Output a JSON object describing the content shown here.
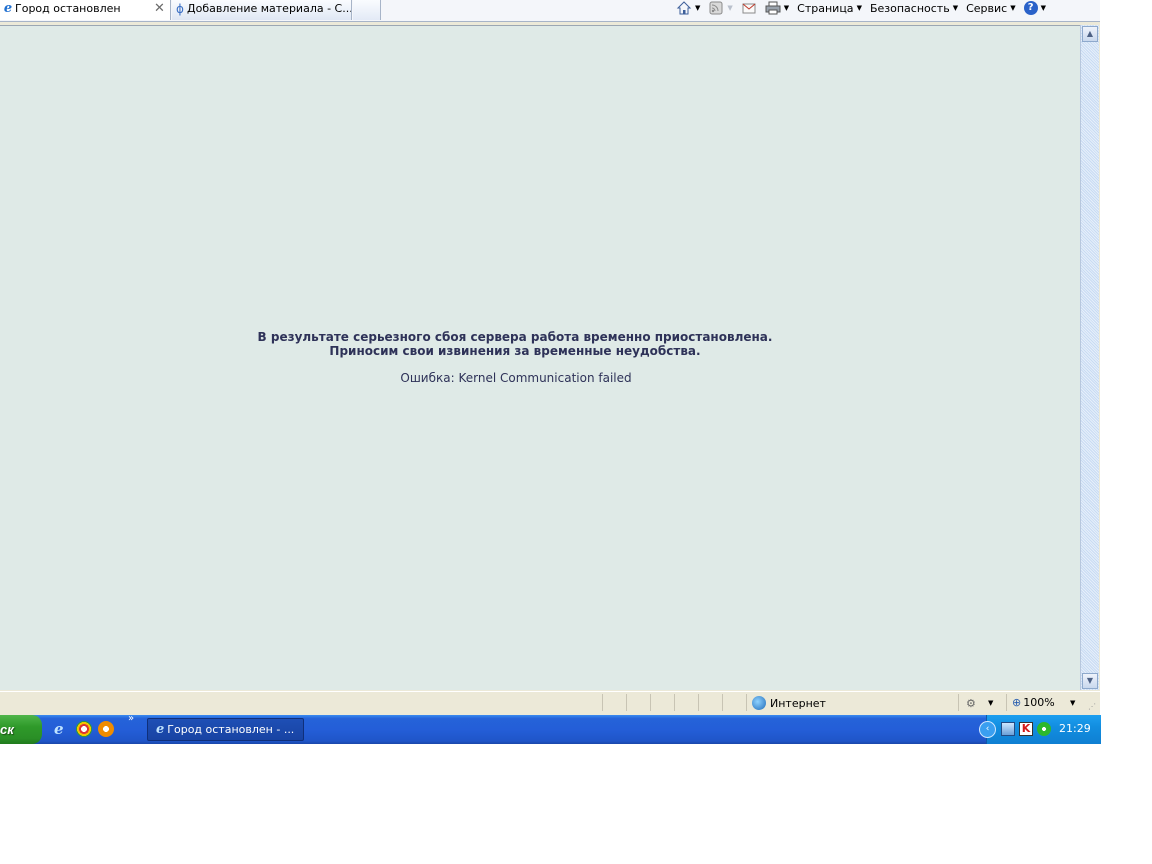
{
  "tabs": [
    {
      "label": "Город остановлен",
      "active": true
    },
    {
      "label": "Добавление материала - С..."
    }
  ],
  "tab_close_glyph": "✕",
  "command_bar": {
    "page_label": "Страница",
    "security_label": "Безопасность",
    "tools_label": "Сервис",
    "help_glyph": "?"
  },
  "page": {
    "line1": "В результате серьезного сбоя сервера работа временно приостановлена.",
    "line2": "Приносим свои извинения за временные неудобства.",
    "error": "Ошибка: Kernel Communication failed",
    "background": "#dfeae7",
    "text_color": "#2e3258"
  },
  "status_bar": {
    "zone_label": "Интернет",
    "zoom_label": "100%"
  },
  "taskbar": {
    "start_label": "ск",
    "task_button_label": "Город остановлен - ...",
    "clock": "21:29"
  },
  "icons": {
    "home": "home-icon",
    "feeds": "rss-icon",
    "mail": "mail-icon",
    "print": "print-icon",
    "help": "help-icon",
    "globe": "globe-icon",
    "zoom": "zoom-icon"
  }
}
